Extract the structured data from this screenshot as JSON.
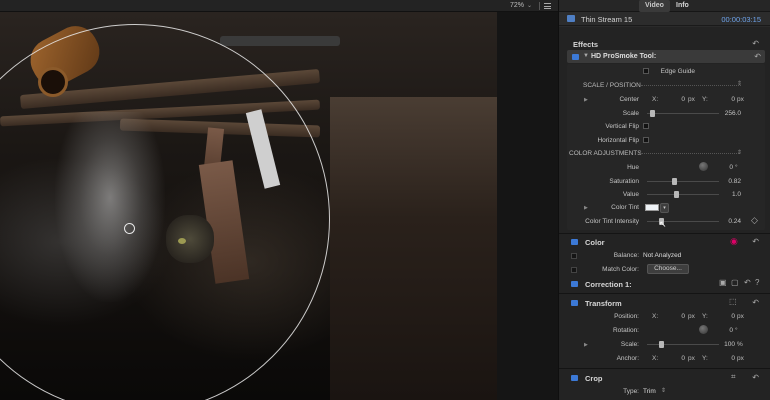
{
  "viewer": {
    "zoom": "72%",
    "zoom_chevron": "⌄"
  },
  "inspector": {
    "tabs": [
      "Video",
      "Info"
    ],
    "clip_name": "Thin Stream 15",
    "timecode": "00:00:03:15",
    "effects": {
      "title": "Effects",
      "plugin": "HD ProSmoke Tool:",
      "edge_guide": "Edge Guide",
      "scale_position": "SCALE / POSITION",
      "center": "Center",
      "center_x": "0",
      "center_y": "0",
      "px": "px",
      "x_label": "X:",
      "y_label": "Y:",
      "scale_label": "Scale",
      "scale_value": "256.0",
      "vertical_flip": "Vertical Flip",
      "horizontal_flip": "Horizontal Flip",
      "color_adjustments": "COLOR ADJUSTMENTS",
      "hue_label": "Hue",
      "hue_value": "0",
      "degree": "°",
      "saturation_label": "Saturation",
      "saturation_value": "0.82",
      "value_label": "Value",
      "value_value": "1.0",
      "color_tint": "Color Tint",
      "tint_intensity_label": "Color Tint Intensity",
      "tint_intensity_value": "0.24"
    },
    "color": {
      "title": "Color",
      "balance_label": "Balance:",
      "balance_value": "Not Analyzed",
      "match_label": "Match Color:",
      "choose_button": "Choose..."
    },
    "correction": {
      "title": "Correction 1:"
    },
    "transform": {
      "title": "Transform",
      "position_label": "Position:",
      "pos_x": "0",
      "pos_y": "0",
      "rotation_label": "Rotation:",
      "rotation_value": "0",
      "scale_label": "Scale:",
      "scale_value": "100",
      "percent": "%",
      "anchor_label": "Anchor:",
      "anchor_x": "0",
      "anchor_y": "0"
    },
    "crop": {
      "title": "Crop",
      "type_label": "Type:",
      "type_value": "Trim"
    },
    "reset_glyph": "↶",
    "colors": {
      "accent": "#3c79d6",
      "timecode": "#6ea3ea"
    }
  }
}
